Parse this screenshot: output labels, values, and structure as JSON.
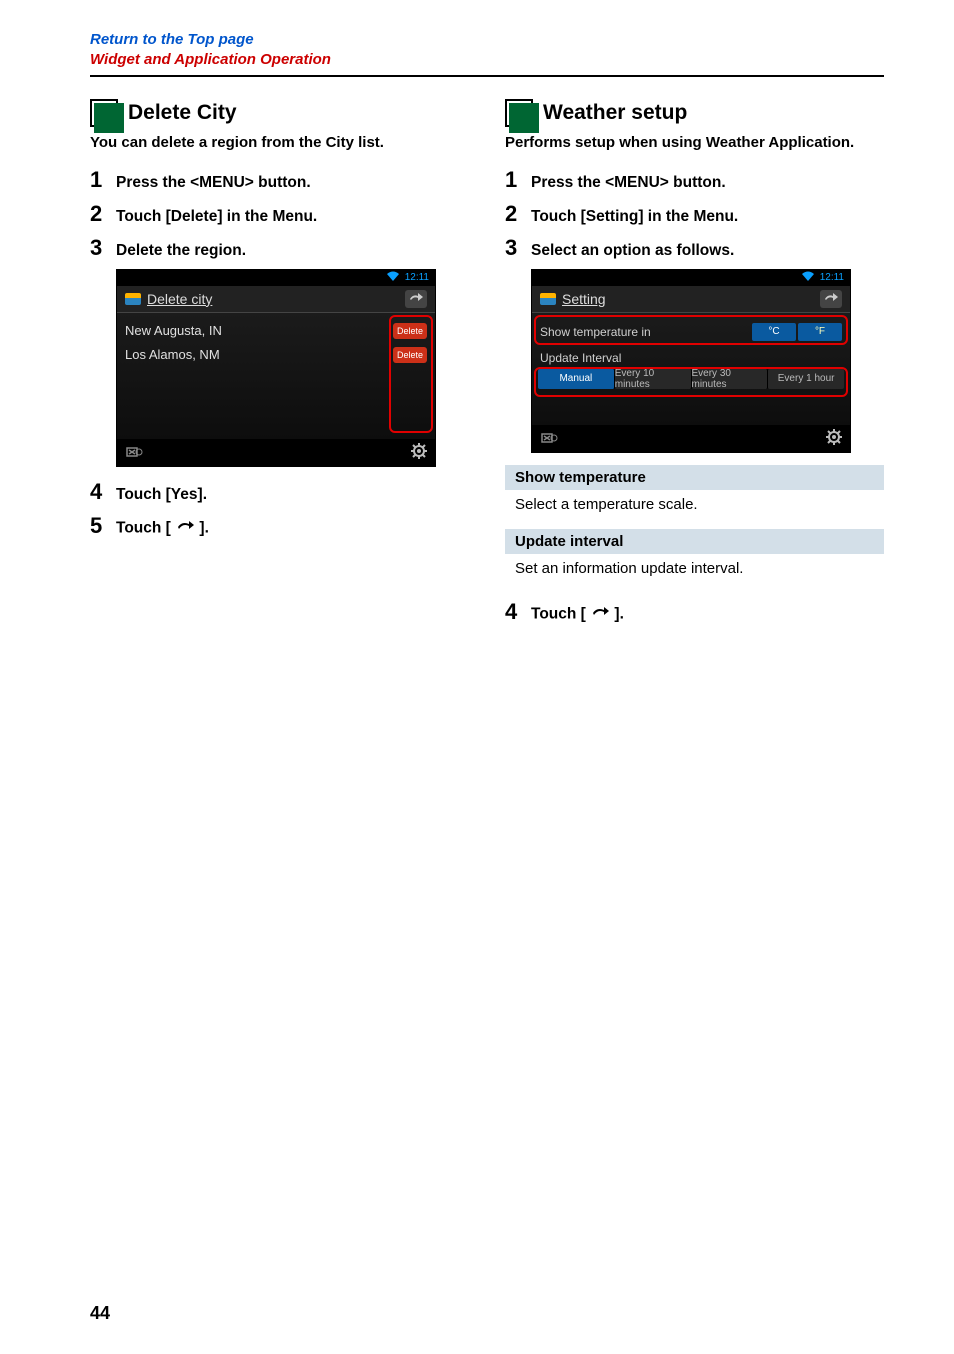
{
  "topLinks": {
    "top": "Return to the Top page",
    "section": "Widget and Application Operation"
  },
  "left": {
    "heading": "Delete City",
    "intro": "You can delete a region from the City list.",
    "steps": {
      "s1": "Press the <MENU> button.",
      "s2": "Touch [Delete] in the Menu.",
      "s3": "Delete the region.",
      "s4": "Touch [Yes].",
      "s5_prefix": "Touch [ ",
      "s5_suffix": " ]."
    },
    "shot": {
      "time": "12:11",
      "title": "Delete city",
      "city1": "New Augusta, IN",
      "city2": "Los Alamos, NM",
      "delete": "Delete"
    }
  },
  "right": {
    "heading": "Weather setup",
    "intro": "Performs setup when using Weather Application.",
    "steps": {
      "s1": "Press the <MENU> button.",
      "s2": "Touch [Setting] in the Menu.",
      "s3": "Select an option as follows.",
      "s4_prefix": "Touch [ ",
      "s4_suffix": " ]."
    },
    "shot": {
      "time": "12:11",
      "title": "Setting",
      "row_temp": "Show temperature in",
      "c": "°C",
      "f": "°F",
      "row_upd": "Update Interval",
      "opt_manual": "Manual",
      "opt_10": "Every 10 minutes",
      "opt_30": "Every 30 minutes",
      "opt_1h": "Every 1 hour"
    },
    "desc": {
      "t1": "Show temperature",
      "b1": "Select a temperature scale.",
      "t2": "Update interval",
      "b2": "Set an information update interval."
    }
  },
  "pageNumber": "44"
}
